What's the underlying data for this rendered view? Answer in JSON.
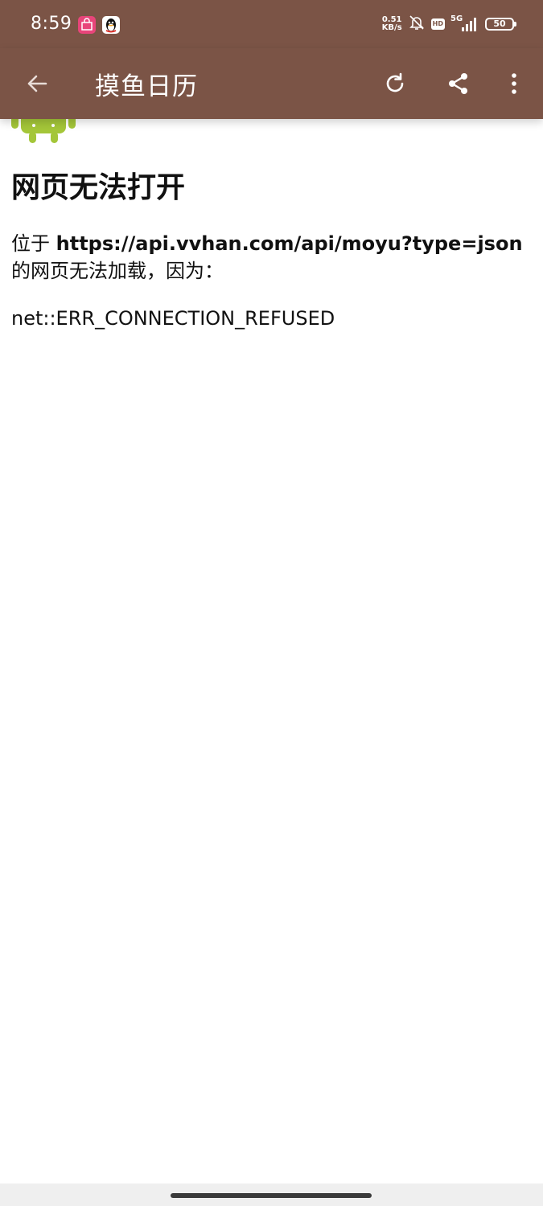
{
  "status_bar": {
    "time": "8:59",
    "speed_value": "0.51",
    "speed_unit": "KB/s",
    "hd": "HD",
    "network": "5G",
    "battery": "50"
  },
  "toolbar": {
    "title": "摸鱼日历"
  },
  "error": {
    "title": "网页无法打开",
    "prefix": "位于 ",
    "url": "https://api.vvhan.com/api/moyu?type=json",
    "suffix": "的网页无法加载，因为：",
    "code": "net::ERR_CONNECTION_REFUSED"
  },
  "colors": {
    "toolbar_bg": "#7b5446",
    "android_green": "#a4c639"
  },
  "icons": {
    "back": "back-arrow-icon",
    "refresh": "refresh-icon",
    "share": "share-icon",
    "more": "more-vert-icon",
    "android": "android-robot-icon"
  }
}
